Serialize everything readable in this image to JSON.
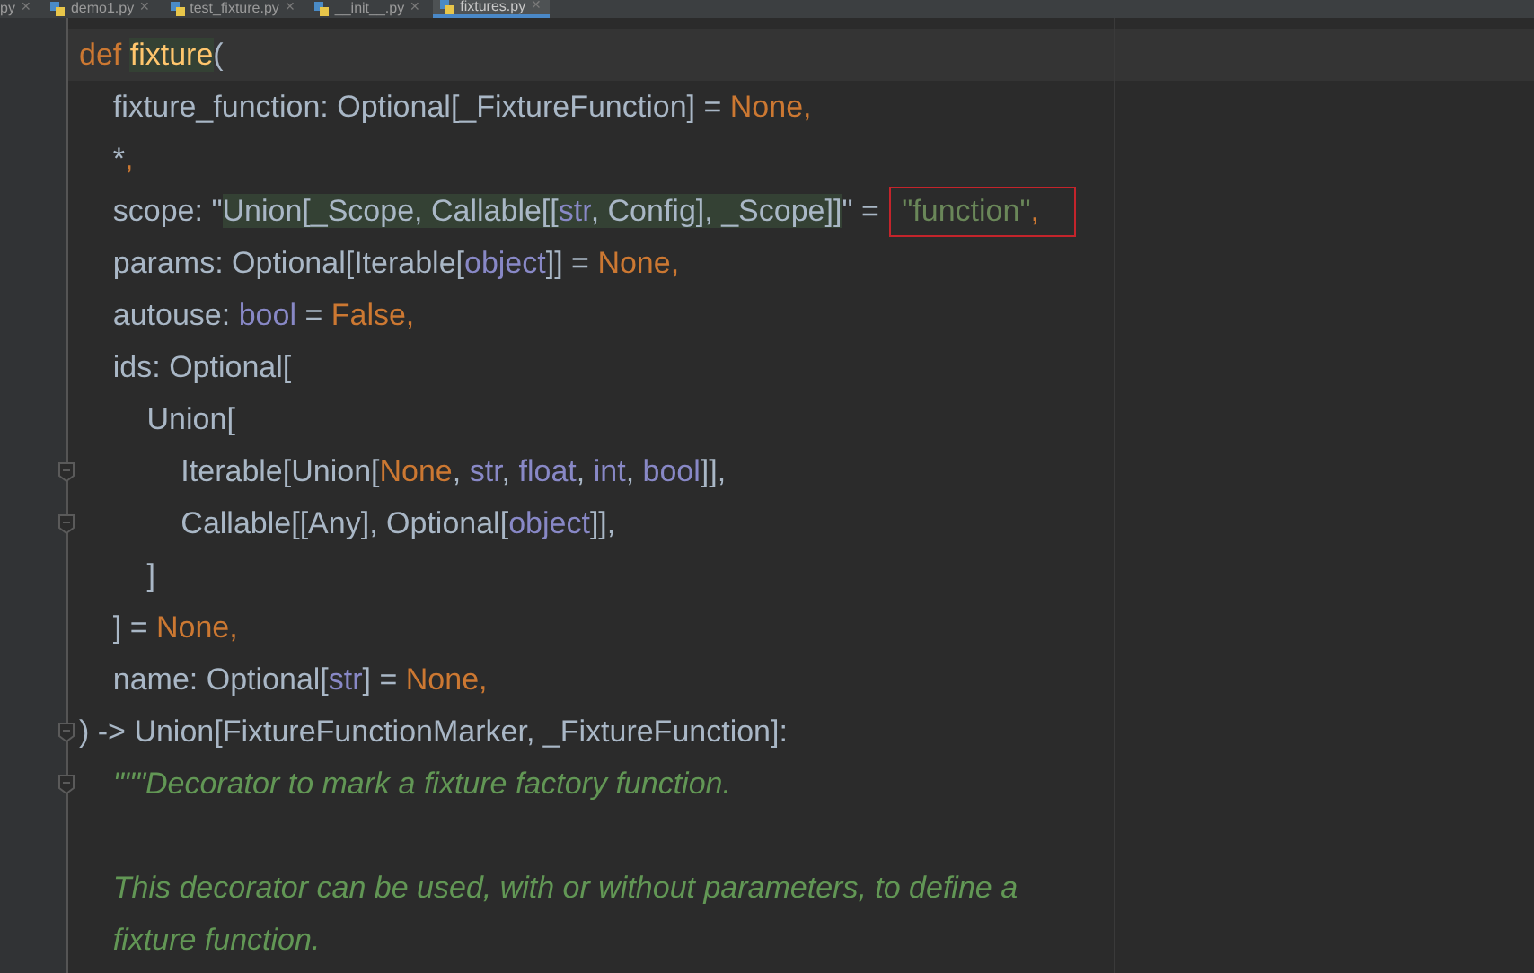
{
  "tabs": [
    {
      "label": "py",
      "selected": false,
      "close": "✕"
    },
    {
      "label": "demo1.py",
      "selected": false,
      "close": "✕"
    },
    {
      "label": "test_fixture.py",
      "selected": false,
      "close": "✕"
    },
    {
      "label": "__init__.py",
      "selected": false,
      "close": "✕"
    },
    {
      "label": "fixtures.py",
      "selected": true,
      "close": "✕"
    }
  ],
  "editor": {
    "lines": [
      {
        "fold": false,
        "current": true,
        "tokens": [
          {
            "text": "def ",
            "kind": "keyword"
          },
          {
            "text": "fixture",
            "kind": "funcname"
          },
          {
            "text": "(",
            "kind": "plain"
          }
        ]
      },
      {
        "fold": false,
        "current": false,
        "tokens": [
          {
            "text": "    fixture_function: Optional[_FixtureFunction] = ",
            "kind": "plain"
          },
          {
            "text": "None,",
            "kind": "keyword"
          }
        ]
      },
      {
        "fold": false,
        "current": false,
        "tokens": [
          {
            "text": "    *",
            "kind": "plain"
          },
          {
            "text": ",",
            "kind": "keyword"
          }
        ]
      },
      {
        "fold": false,
        "current": false,
        "tokens": [
          {
            "text": "    scope: \"",
            "kind": "plain"
          },
          {
            "text": "Union[_Scope, Callable[[",
            "kind": "injected"
          },
          {
            "text": "str",
            "kind": "injected_type"
          },
          {
            "text": ", Config], _Scope]]",
            "kind": "injected"
          },
          {
            "text": "\" = ",
            "kind": "plain"
          },
          {
            "text": "\"function\"",
            "kind": "string",
            "boxed": true
          },
          {
            "text": ",",
            "kind": "keyword",
            "boxed": true
          }
        ]
      },
      {
        "fold": false,
        "current": false,
        "tokens": [
          {
            "text": "    params: Optional[Iterable[",
            "kind": "plain"
          },
          {
            "text": "object",
            "kind": "type"
          },
          {
            "text": "]] = ",
            "kind": "plain"
          },
          {
            "text": "None,",
            "kind": "keyword"
          }
        ]
      },
      {
        "fold": false,
        "current": false,
        "tokens": [
          {
            "text": "    autouse: ",
            "kind": "plain"
          },
          {
            "text": "bool",
            "kind": "type"
          },
          {
            "text": " = ",
            "kind": "plain"
          },
          {
            "text": "False,",
            "kind": "keyword"
          }
        ]
      },
      {
        "fold": false,
        "current": false,
        "tokens": [
          {
            "text": "    ids: Optional[",
            "kind": "plain"
          }
        ]
      },
      {
        "fold": false,
        "current": false,
        "tokens": [
          {
            "text": "        Union[",
            "kind": "plain"
          }
        ]
      },
      {
        "fold": true,
        "current": false,
        "tokens": [
          {
            "text": "            Iterable[Union[",
            "kind": "plain"
          },
          {
            "text": "None",
            "kind": "keyword"
          },
          {
            "text": ", ",
            "kind": "plain"
          },
          {
            "text": "str",
            "kind": "type"
          },
          {
            "text": ", ",
            "kind": "plain"
          },
          {
            "text": "float",
            "kind": "type"
          },
          {
            "text": ", ",
            "kind": "plain"
          },
          {
            "text": "int",
            "kind": "type"
          },
          {
            "text": ", ",
            "kind": "plain"
          },
          {
            "text": "bool",
            "kind": "type"
          },
          {
            "text": "]],",
            "kind": "plain"
          }
        ]
      },
      {
        "fold": true,
        "current": false,
        "tokens": [
          {
            "text": "            Callable[[Any], Optional[",
            "kind": "plain"
          },
          {
            "text": "object",
            "kind": "type"
          },
          {
            "text": "]],",
            "kind": "plain"
          }
        ]
      },
      {
        "fold": false,
        "current": false,
        "tokens": [
          {
            "text": "        ]",
            "kind": "plain"
          }
        ]
      },
      {
        "fold": false,
        "current": false,
        "tokens": [
          {
            "text": "    ] = ",
            "kind": "plain"
          },
          {
            "text": "None,",
            "kind": "keyword"
          }
        ]
      },
      {
        "fold": false,
        "current": false,
        "tokens": [
          {
            "text": "    name: Optional[",
            "kind": "plain"
          },
          {
            "text": "str",
            "kind": "type"
          },
          {
            "text": "] = ",
            "kind": "plain"
          },
          {
            "text": "None,",
            "kind": "keyword"
          }
        ]
      },
      {
        "fold": true,
        "current": false,
        "tokens": [
          {
            "text": ") -> Union[FixtureFunctionMarker, _FixtureFunction]:",
            "kind": "plain"
          }
        ]
      },
      {
        "fold": true,
        "current": false,
        "tokens": [
          {
            "text": "    \"\"\"Decorator to mark a fixture factory function.",
            "kind": "docstring"
          }
        ]
      },
      {
        "fold": false,
        "current": false
      },
      {
        "fold": false,
        "current": false,
        "tokens": [
          {
            "text": "    This decorator can be used, with or without parameters, to define a",
            "kind": "docstring"
          }
        ]
      },
      {
        "fold": false,
        "current": false,
        "tokens": [
          {
            "text": "    fixture function.",
            "kind": "docstring"
          }
        ]
      }
    ]
  }
}
